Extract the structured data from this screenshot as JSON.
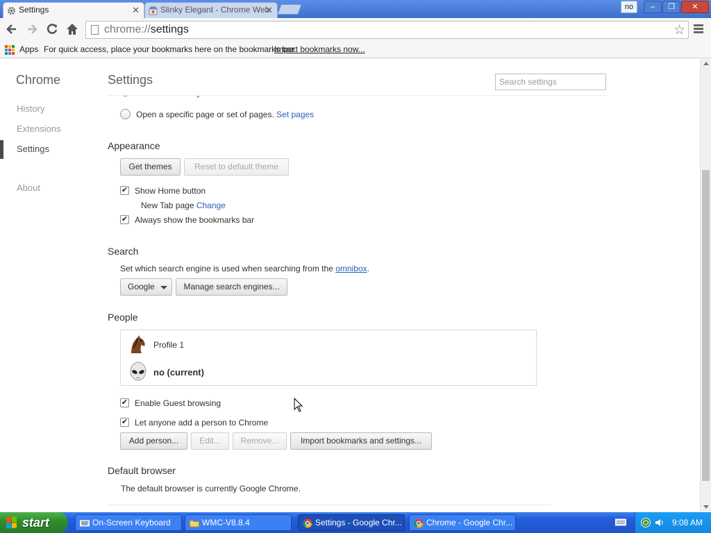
{
  "window": {
    "tabs": [
      {
        "label": "Settings",
        "active": true
      },
      {
        "label": "Slinky Elegant - Chrome Web",
        "active": false
      }
    ],
    "user_badge": "no",
    "controls": {
      "minimize": "–",
      "maximize": "❐",
      "close": "✕"
    }
  },
  "toolbar": {
    "url_scheme": "chrome://",
    "url_path": "settings",
    "icons": [
      "back-arrow-icon",
      "forward-arrow-icon",
      "reload-icon",
      "home-icon",
      "page-icon",
      "star-icon",
      "menu-icon"
    ]
  },
  "bookmarks": {
    "apps_label": "Apps",
    "hint": "For quick access, place your bookmarks here on the bookmarks bar.",
    "import_link": "Import bookmarks now..."
  },
  "sidebar": {
    "title": "Chrome",
    "items": [
      {
        "label": "History",
        "active": false
      },
      {
        "label": "Extensions",
        "active": false
      },
      {
        "label": "Settings",
        "active": true
      },
      {
        "label": "About",
        "active": false
      }
    ]
  },
  "main": {
    "title": "Settings",
    "search_placeholder": "Search settings",
    "startup": {
      "option_partial": "Continue where you left off",
      "option_pages": "Open a specific page or set of pages.",
      "set_pages_link": "Set pages"
    },
    "appearance": {
      "title": "Appearance",
      "get_themes": "Get themes",
      "reset_theme": "Reset to default theme",
      "show_home": "Show Home button",
      "show_home_checked": true,
      "new_tab_label": "New Tab page",
      "change_link": "Change",
      "show_bookmarks": "Always show the bookmarks bar",
      "show_bookmarks_checked": true
    },
    "search": {
      "title": "Search",
      "description": "Set which search engine is used when searching from the",
      "omnibox_link": "omnibox",
      "period": ".",
      "engine": "Google",
      "manage": "Manage search engines..."
    },
    "people": {
      "title": "People",
      "profiles": [
        {
          "name": "Profile 1",
          "avatar": "horse-avatar-icon",
          "current": false
        },
        {
          "name": "no (current)",
          "avatar": "alien-avatar-icon",
          "current": true
        }
      ],
      "guest_browsing": "Enable Guest browsing",
      "guest_checked": true,
      "anyone_add": "Let anyone add a person to Chrome",
      "anyone_checked": true,
      "add_person": "Add person...",
      "edit": "Edit...",
      "remove": "Remove...",
      "import": "Import bookmarks and settings..."
    },
    "default_browser": {
      "title": "Default browser",
      "description": "The default browser is currently Google Chrome."
    }
  },
  "taskbar": {
    "start_label": "start",
    "tasks": [
      {
        "label": "On-Screen Keyboard",
        "icon": "keyboard-icon",
        "active": false
      },
      {
        "label": "WMC-V8.8.4",
        "icon": "folder-icon",
        "active": false
      },
      {
        "label": "Settings - Google Chr...",
        "icon": "chrome-icon",
        "active": true
      },
      {
        "label": "Chrome - Google Chr...",
        "icon": "chrome-icon",
        "active": false
      }
    ],
    "clock": "9:08 AM"
  },
  "colors": {
    "link": "#2a5db0",
    "taskbar": "#245edb",
    "start_button": "#2f8f2f",
    "title_bar": "#4a7dd6"
  }
}
